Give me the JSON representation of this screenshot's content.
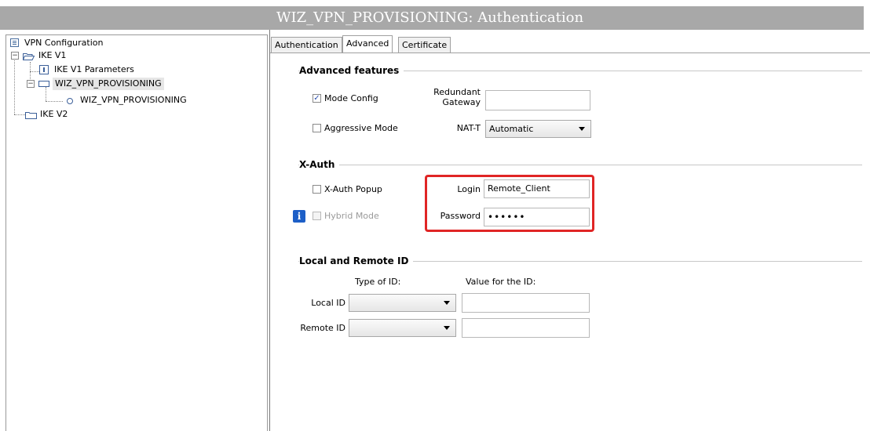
{
  "header": {
    "title": "WIZ_VPN_PROVISIONING: Authentication"
  },
  "tree": {
    "root": {
      "label": "VPN Configuration",
      "icon": "list-document-icon"
    },
    "items": [
      {
        "label": "IKE V1",
        "icon": "open-folder-icon",
        "expander": "−"
      },
      {
        "label": "IKE V1 Parameters",
        "icon": "parameters-icon"
      },
      {
        "label": "WIZ_VPN_PROVISIONING",
        "icon": "phase1-rect-icon",
        "expander": "−",
        "selected": true
      },
      {
        "label": "WIZ_VPN_PROVISIONING",
        "icon": "circle-node-icon"
      },
      {
        "label": "IKE V2",
        "icon": "closed-folder-icon"
      }
    ]
  },
  "tabs": [
    {
      "label": "Authentication",
      "active": false
    },
    {
      "label": "Advanced",
      "active": true
    },
    {
      "label": "Certificate",
      "active": false
    }
  ],
  "advanced_features": {
    "title": "Advanced features",
    "mode_config": {
      "label": "Mode Config",
      "checked": true
    },
    "aggressive_mode": {
      "label": "Aggressive Mode",
      "checked": false
    },
    "redundant_gateway": {
      "label_line1": "Redundant",
      "label_line2": "Gateway",
      "value": ""
    },
    "nat_t": {
      "label": "NAT-T",
      "value": "Automatic"
    }
  },
  "xauth": {
    "title": "X-Auth",
    "popup": {
      "label": "X-Auth Popup",
      "checked": false
    },
    "hybrid_mode": {
      "label": "Hybrid Mode",
      "checked": false,
      "disabled": true
    },
    "info_icon": "i",
    "login": {
      "label": "Login",
      "value": "Remote_Client"
    },
    "password": {
      "label": "Password",
      "value": "••••••"
    },
    "highlight_color": "#e02525"
  },
  "local_remote_id": {
    "title": "Local and Remote ID",
    "type_header": "Type of ID:",
    "value_header": "Value for the ID:",
    "local": {
      "label": "Local ID",
      "type": "",
      "value": ""
    },
    "remote": {
      "label": "Remote ID",
      "type": "",
      "value": ""
    }
  }
}
